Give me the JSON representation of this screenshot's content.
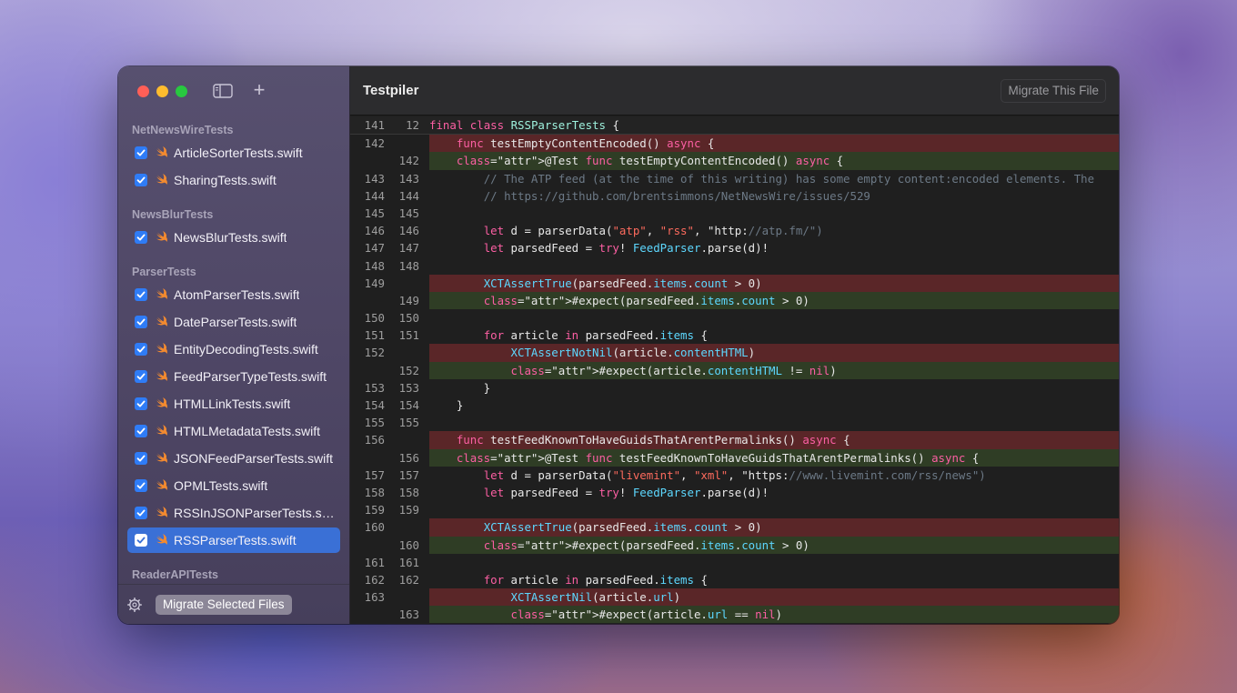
{
  "app": {
    "title": "Testpiler",
    "migrate_file_label": "Migrate This File",
    "migrate_selected_label": "Migrate Selected Files"
  },
  "sidebar": {
    "groups": [
      {
        "title": "NetNewsWireTests",
        "files": [
          "ArticleSorterTests.swift",
          "SharingTests.swift"
        ]
      },
      {
        "title": "NewsBlurTests",
        "files": [
          "NewsBlurTests.swift"
        ]
      },
      {
        "title": "ParserTests",
        "files": [
          "AtomParserTests.swift",
          "DateParserTests.swift",
          "EntityDecodingTests.swift",
          "FeedParserTypeTests.swift",
          "HTMLLinkTests.swift",
          "HTMLMetadataTests.swift",
          "JSONFeedParserTests.swift",
          "OPMLTests.swift",
          "RSSInJSONParserTests.swift",
          "RSSParserTests.swift"
        ]
      },
      {
        "title": "ReaderAPITests",
        "files": []
      }
    ],
    "selected_file": "RSSParserTests.swift"
  },
  "colors": {
    "accent": "#3a70d6",
    "removed": "#5a2628",
    "added": "#2f3d25"
  },
  "code": {
    "lines": [
      {
        "old": "141",
        "new": "12",
        "text": "final class RSSParserTests {",
        "kind": "first"
      },
      {
        "old": "142",
        "new": "",
        "text": "    func testEmptyContentEncoded() async {",
        "kind": "removed"
      },
      {
        "old": "",
        "new": "142",
        "text": "    @Test func testEmptyContentEncoded() async {",
        "kind": "added"
      },
      {
        "old": "143",
        "new": "143",
        "text": "        // The ATP feed (at the time of this writing) has some empty content:encoded elements. The",
        "kind": "normal"
      },
      {
        "old": "144",
        "new": "144",
        "text": "        // https://github.com/brentsimmons/NetNewsWire/issues/529",
        "kind": "normal"
      },
      {
        "old": "145",
        "new": "145",
        "text": "",
        "kind": "normal"
      },
      {
        "old": "146",
        "new": "146",
        "text": "        let d = parserData(\"atp\", \"rss\", \"http://atp.fm/\")",
        "kind": "normal"
      },
      {
        "old": "147",
        "new": "147",
        "text": "        let parsedFeed = try! FeedParser.parse(d)!",
        "kind": "normal"
      },
      {
        "old": "148",
        "new": "148",
        "text": "",
        "kind": "normal"
      },
      {
        "old": "149",
        "new": "",
        "text": "        XCTAssertTrue(parsedFeed.items.count > 0)",
        "kind": "removed"
      },
      {
        "old": "",
        "new": "149",
        "text": "        #expect(parsedFeed.items.count > 0)",
        "kind": "added"
      },
      {
        "old": "150",
        "new": "150",
        "text": "",
        "kind": "normal"
      },
      {
        "old": "151",
        "new": "151",
        "text": "        for article in parsedFeed.items {",
        "kind": "normal"
      },
      {
        "old": "152",
        "new": "",
        "text": "            XCTAssertNotNil(article.contentHTML)",
        "kind": "removed"
      },
      {
        "old": "",
        "new": "152",
        "text": "            #expect(article.contentHTML != nil)",
        "kind": "added"
      },
      {
        "old": "153",
        "new": "153",
        "text": "        }",
        "kind": "normal"
      },
      {
        "old": "154",
        "new": "154",
        "text": "    }",
        "kind": "normal"
      },
      {
        "old": "155",
        "new": "155",
        "text": "",
        "kind": "normal"
      },
      {
        "old": "156",
        "new": "",
        "text": "    func testFeedKnownToHaveGuidsThatArentPermalinks() async {",
        "kind": "removed"
      },
      {
        "old": "",
        "new": "156",
        "text": "    @Test func testFeedKnownToHaveGuidsThatArentPermalinks() async {",
        "kind": "added"
      },
      {
        "old": "157",
        "new": "157",
        "text": "        let d = parserData(\"livemint\", \"xml\", \"https://www.livemint.com/rss/news\")",
        "kind": "normal"
      },
      {
        "old": "158",
        "new": "158",
        "text": "        let parsedFeed = try! FeedParser.parse(d)!",
        "kind": "normal"
      },
      {
        "old": "159",
        "new": "159",
        "text": "",
        "kind": "normal"
      },
      {
        "old": "160",
        "new": "",
        "text": "        XCTAssertTrue(parsedFeed.items.count > 0)",
        "kind": "removed"
      },
      {
        "old": "",
        "new": "160",
        "text": "        #expect(parsedFeed.items.count > 0)",
        "kind": "added"
      },
      {
        "old": "161",
        "new": "161",
        "text": "",
        "kind": "normal"
      },
      {
        "old": "162",
        "new": "162",
        "text": "        for article in parsedFeed.items {",
        "kind": "normal"
      },
      {
        "old": "163",
        "new": "",
        "text": "            XCTAssertNil(article.url)",
        "kind": "removed"
      },
      {
        "old": "",
        "new": "163",
        "text": "            #expect(article.url == nil)",
        "kind": "added"
      }
    ]
  },
  "icons": {
    "sidebar_toggle": "sidebar-toggle-icon",
    "add": "plus-icon",
    "settings": "gear-icon",
    "file": "swift-icon",
    "checkbox": "checkmark-icon"
  }
}
